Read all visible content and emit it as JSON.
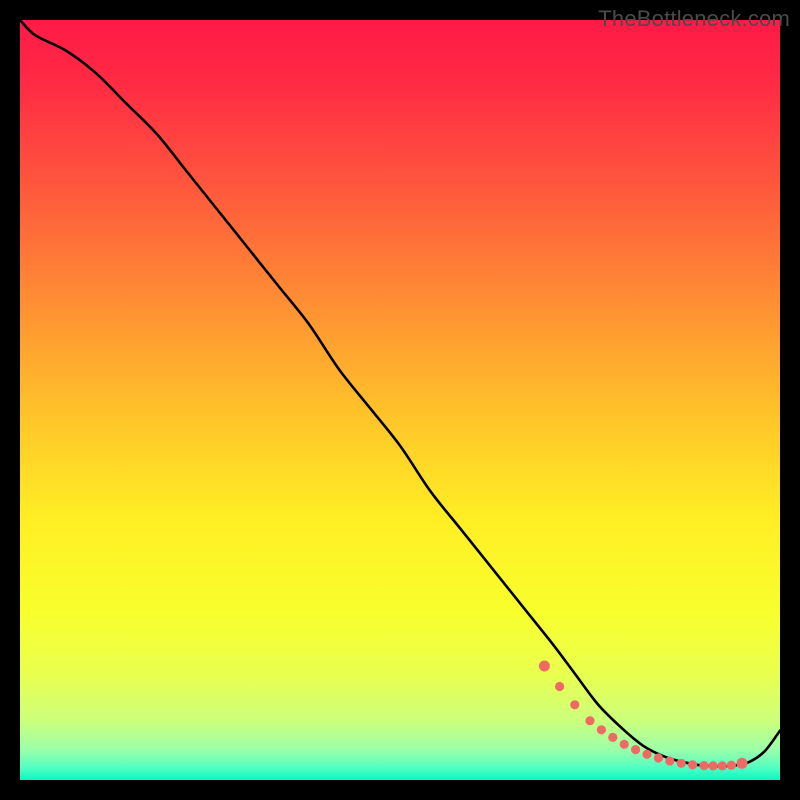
{
  "watermark": "TheBottleneck.com",
  "gradient": {
    "stops": [
      {
        "offset": 0.0,
        "color": "#ff1a46"
      },
      {
        "offset": 0.08,
        "color": "#ff2a44"
      },
      {
        "offset": 0.18,
        "color": "#ff4a3f"
      },
      {
        "offset": 0.3,
        "color": "#ff7438"
      },
      {
        "offset": 0.42,
        "color": "#ffa030"
      },
      {
        "offset": 0.55,
        "color": "#ffce28"
      },
      {
        "offset": 0.66,
        "color": "#ffef24"
      },
      {
        "offset": 0.78,
        "color": "#f8ff2c"
      },
      {
        "offset": 0.86,
        "color": "#e9ff4e"
      },
      {
        "offset": 0.92,
        "color": "#cdff7a"
      },
      {
        "offset": 0.96,
        "color": "#9cffa8"
      },
      {
        "offset": 0.985,
        "color": "#4effc4"
      },
      {
        "offset": 1.0,
        "color": "#08f8c0"
      }
    ]
  },
  "chart_data": {
    "type": "line",
    "title": "",
    "xlabel": "",
    "ylabel": "",
    "xlim": [
      0,
      100
    ],
    "ylim": [
      0,
      100
    ],
    "grid": false,
    "series": [
      {
        "name": "bottleneck-curve",
        "x": [
          0,
          2,
          6,
          10,
          14,
          18,
          22,
          26,
          30,
          34,
          38,
          42,
          46,
          50,
          54,
          58,
          62,
          66,
          70,
          73,
          76,
          79,
          82,
          85,
          88,
          90,
          92,
          94,
          96,
          98,
          100
        ],
        "y": [
          100,
          98,
          96,
          93,
          89,
          85,
          80,
          75,
          70,
          65,
          60,
          54,
          49,
          44,
          38,
          33,
          28,
          23,
          18,
          14,
          10,
          7,
          4.5,
          3.0,
          2.2,
          1.9,
          1.8,
          1.9,
          2.4,
          3.8,
          6.5
        ]
      }
    ],
    "markers": {
      "name": "highlighted-range",
      "color": "#ef6a65",
      "style": "dots",
      "x": [
        69,
        71,
        73,
        75,
        76.5,
        78,
        79.5,
        81,
        82.5,
        84,
        85.5,
        87,
        88.5,
        90,
        91.2,
        92.4,
        93.6,
        95
      ],
      "y": [
        15,
        12.3,
        9.9,
        7.8,
        6.6,
        5.6,
        4.7,
        4.0,
        3.4,
        2.9,
        2.5,
        2.2,
        2.0,
        1.9,
        1.85,
        1.85,
        1.95,
        2.2
      ]
    }
  }
}
